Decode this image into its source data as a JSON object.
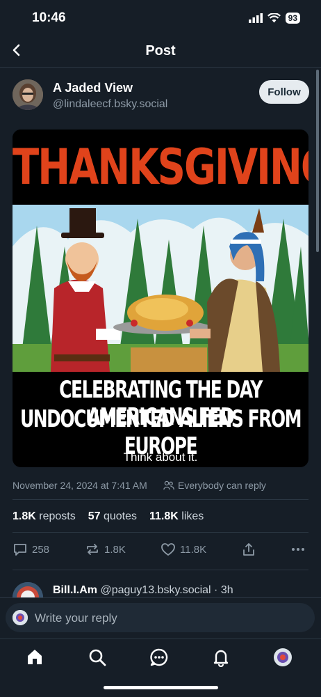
{
  "status_bar": {
    "time": "10:46",
    "battery": "93"
  },
  "header": {
    "title": "Post"
  },
  "post": {
    "author_name": "A Jaded View",
    "author_handle": "@lindaleecf.bsky.social",
    "follow_label": "Follow",
    "image": {
      "headline": "THANKSGIVING",
      "caption_line_1": "CELEBRATING THE DAY AMERICANS FED",
      "caption_line_2": "UNDOCUMENTED ALIENS FROM EUROPE",
      "footer": "Think about it."
    },
    "timestamp": "November 24, 2024 at 7:41 AM",
    "reply_permission": "Everybody can reply",
    "stats": {
      "reposts_count": "1.8K",
      "reposts_label": " reposts",
      "quotes_count": "57",
      "quotes_label": " quotes",
      "likes_count": "11.8K",
      "likes_label": " likes"
    },
    "actions": {
      "replies": "258",
      "reposts": "1.8K",
      "likes": "11.8K"
    }
  },
  "next_post": {
    "author_name": "Bill.I.Am",
    "author_handle": " @paguy13.bsky.social",
    "age": " · 3h"
  },
  "composer": {
    "placeholder": "Write your reply"
  },
  "tabs": [
    "home-icon",
    "search-icon",
    "chat-icon",
    "notifications-icon",
    "profile-avatar"
  ],
  "colors": {
    "background": "#161e27",
    "accent_red": "#e0431b",
    "muted": "#8d9aa6"
  }
}
